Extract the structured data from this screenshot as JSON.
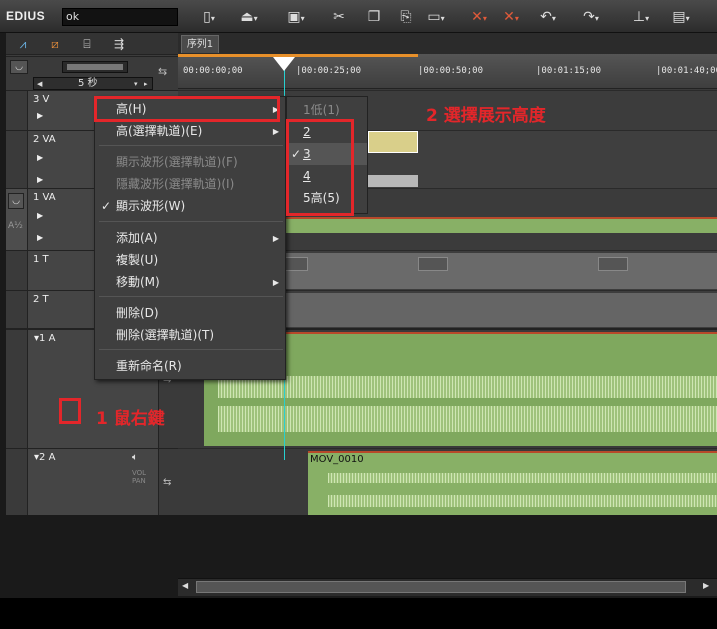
{
  "app": {
    "logo": "EDIUS",
    "project_name": "ok"
  },
  "toolbar": {
    "icons": [
      "new-icon",
      "export-icon",
      "save-icon",
      "cut-icon",
      "copy-icon",
      "paste-icon",
      "clip-icon",
      "delete-icon",
      "ripple-delete-icon",
      "undo-icon",
      "redo-icon",
      "mixer-icon",
      "render-icon"
    ]
  },
  "left_tools": {
    "zoom_value": "5 秒"
  },
  "sequence_tab": "序列1",
  "ruler": {
    "times": [
      "00:00:00;00",
      "|00:00:25;00",
      "|00:00:50;00",
      "|00:01:15;00",
      "|00:01:40;00"
    ]
  },
  "tracks": [
    {
      "name": "3 V"
    },
    {
      "name": "2 VA"
    },
    {
      "name": "1 VA"
    },
    {
      "name": "1 T"
    },
    {
      "name": "2 T"
    },
    {
      "name": "1 A"
    },
    {
      "name": "2 A",
      "vol_label": "VOL",
      "pan_label": "PAN"
    }
  ],
  "clips": {
    "audio2_clip": "MOV_0010"
  },
  "context_menu": {
    "items": [
      {
        "label": "高(H)",
        "submenu": true
      },
      {
        "label": "高(選擇軌道)(E)",
        "submenu": true
      },
      {
        "label": "顯示波形(選擇軌道)(F)",
        "disabled": true
      },
      {
        "label": "隱藏波形(選擇軌道)(I)",
        "disabled": true
      },
      {
        "label": "顯示波形(W)",
        "checked": true
      },
      {
        "label": "添加(A)",
        "submenu": true
      },
      {
        "label": "複製(U)"
      },
      {
        "label": "移動(M)",
        "submenu": true
      },
      {
        "label": "刪除(D)"
      },
      {
        "label": "刪除(選擇軌道)(T)"
      },
      {
        "label": "重新命名(R)"
      }
    ]
  },
  "height_submenu": {
    "items": [
      {
        "label": "1低(1)",
        "disabled": true
      },
      {
        "label": "2"
      },
      {
        "label": "3",
        "checked": true
      },
      {
        "label": "4"
      },
      {
        "label": "5高(5)"
      }
    ]
  },
  "annotations": {
    "step1": "1 鼠右鍵",
    "step2": "2 選擇展示高度"
  },
  "colors": {
    "annotation_red": "#e3262a",
    "clip_green": "#88b066",
    "playhead": "#28d0d0"
  }
}
